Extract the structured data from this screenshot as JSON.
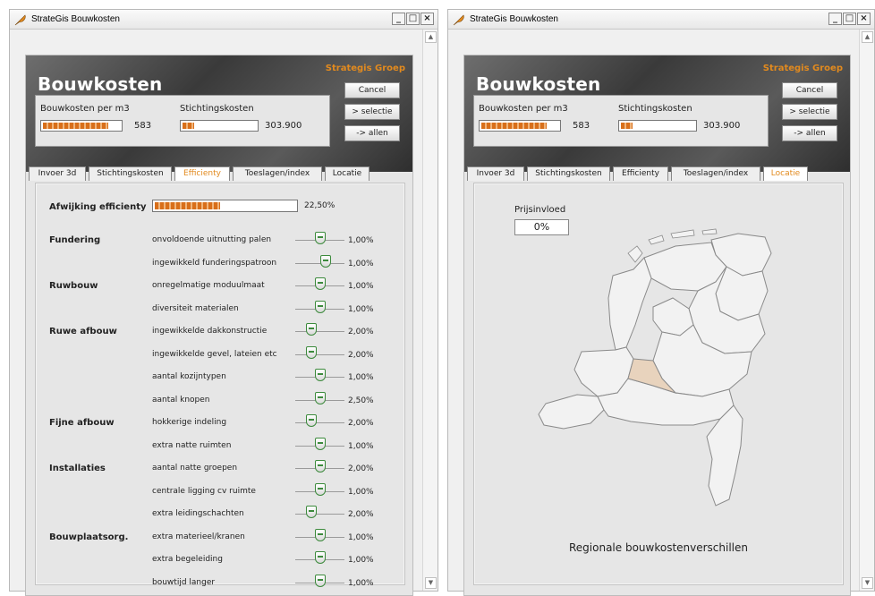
{
  "windows": {
    "left": {
      "title": "StrateGis Bouwkosten"
    },
    "right": {
      "title": "StrateGis Bouwkosten"
    }
  },
  "window_controls": {
    "minimize": "_",
    "maximize": "□",
    "close": "×"
  },
  "app": {
    "title": "Bouwkosten",
    "brand": "Strategis Groep",
    "buttons": {
      "cancel": "Cancel",
      "selectie": "> selectie",
      "allen": "-> allen"
    },
    "costs": {
      "per_m3_label": "Bouwkosten per m3",
      "per_m3_value": "583",
      "per_m3_fill": 0.85,
      "stichting_label": "Stichtingskosten",
      "stichting_value": "303.900",
      "stichting_fill": 0.2
    },
    "tabs": [
      "Invoer 3d",
      "Stichtingskosten",
      "Efficienty",
      "Toeslagen/index",
      "Locatie"
    ]
  },
  "efficiency": {
    "label": "Afwijking efficienty",
    "value": "22,50%",
    "fill": 0.48,
    "rows": [
      {
        "category": "Fundering",
        "item": "onvoldoende uitnutting palen",
        "value": "1,00%",
        "level": 0.5
      },
      {
        "category": "",
        "item": "ingewikkeld funderingspatroon",
        "value": "1,00%",
        "level": 0.62
      },
      {
        "category": "Ruwbouw",
        "item": "onregelmatige moduulmaat",
        "value": "1,00%",
        "level": 0.5
      },
      {
        "category": "",
        "item": "diversiteit materialen",
        "value": "1,00%",
        "level": 0.5
      },
      {
        "category": "Ruwe afbouw",
        "item": "ingewikkelde dakkonstructie",
        "value": "2,00%",
        "level": 0.33
      },
      {
        "category": "",
        "item": "ingewikkelde gevel, lateien etc",
        "value": "2,00%",
        "level": 0.33
      },
      {
        "category": "",
        "item": "aantal kozijntypen",
        "value": "1,00%",
        "level": 0.5
      },
      {
        "category": "",
        "item": "aantal knopen",
        "value": "2,50%",
        "level": 0.5
      },
      {
        "category": "Fijne afbouw",
        "item": "hokkerige indeling",
        "value": "2,00%",
        "level": 0.33
      },
      {
        "category": "",
        "item": "extra natte ruimten",
        "value": "1,00%",
        "level": 0.5
      },
      {
        "category": "Installaties",
        "item": "aantal natte groepen",
        "value": "2,00%",
        "level": 0.5
      },
      {
        "category": "",
        "item": "centrale ligging cv ruimte",
        "value": "1,00%",
        "level": 0.5
      },
      {
        "category": "",
        "item": "extra leidingschachten",
        "value": "2,00%",
        "level": 0.33
      },
      {
        "category": "Bouwplaatsorg.",
        "item": "extra materieel/kranen",
        "value": "1,00%",
        "level": 0.5
      },
      {
        "category": "",
        "item": "extra begeleiding",
        "value": "1,00%",
        "level": 0.5
      },
      {
        "category": "",
        "item": "bouwtijd langer",
        "value": "1,00%",
        "level": 0.5
      }
    ]
  },
  "location": {
    "price_label": "Prijsinvloed",
    "price_value": "0%",
    "caption": "Regionale bouwkostenverschillen",
    "highlight_color": "#e8d3bd"
  },
  "colors": {
    "accent": "#e28a1e",
    "bar_fill": "#d86f1a",
    "slider": "#3c8a3c"
  }
}
